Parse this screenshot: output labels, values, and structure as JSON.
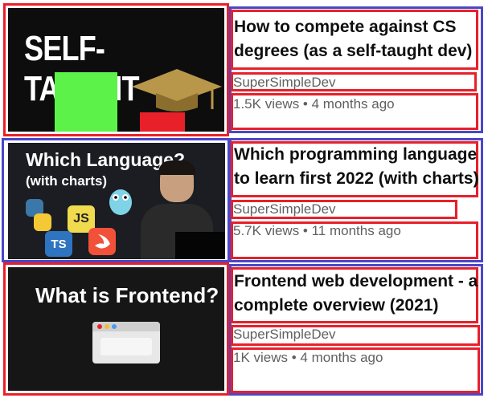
{
  "videos": [
    {
      "title_line1": "How to compete against CS",
      "title_line2": "degrees (as a self-taught dev)",
      "channel": "SuperSimpleDev",
      "meta": "1.5K views • 4 months ago",
      "thumb_text": "SELF-TAUGHT"
    },
    {
      "title_line1": "Which programming language",
      "title_line2": "to learn first 2022 (with charts)",
      "channel": "SuperSimpleDev",
      "meta": "5.7K views • 11 months ago",
      "thumb_title": "Which Language?",
      "thumb_sub": "(with charts)",
      "badges": [
        "JS",
        "TS"
      ]
    },
    {
      "title_line1": "Frontend web development - a",
      "title_line2": "complete overview (2021)",
      "channel": "SuperSimpleDev",
      "meta": "1K views • 4 months ago",
      "thumb_title": "What is Frontend?"
    }
  ],
  "colors": {
    "annotation_red": "#e8202a",
    "annotation_blue": "#4a47c8",
    "title": "#0f0f0f",
    "secondary": "#606060"
  },
  "icons": [
    "python-logo-icon",
    "go-gopher-icon",
    "swift-logo-icon",
    "browser-window-icon",
    "graduation-cap-icon"
  ]
}
